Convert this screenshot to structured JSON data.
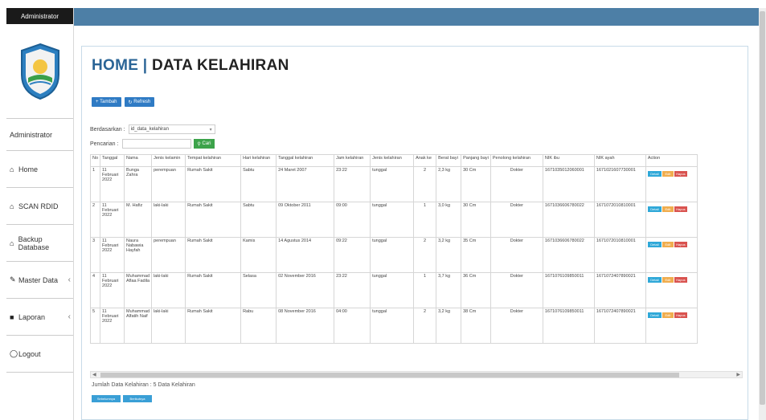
{
  "sidebar": {
    "header": "Administrator",
    "user": "Administrator",
    "items": [
      {
        "label": "Home",
        "icon": "home-icon"
      },
      {
        "label": "SCAN RDID",
        "icon": "home-icon"
      },
      {
        "label": "Backup Database",
        "icon": "home-icon"
      },
      {
        "label": "Master Data",
        "icon": "edit-icon",
        "expandable": true
      },
      {
        "label": "Laporan",
        "icon": "book-icon",
        "expandable": true
      },
      {
        "label": "Logout",
        "icon": "power-icon"
      }
    ]
  },
  "header": {
    "home": "HOME",
    "separator": "|",
    "page": "DATA KELAHIRAN"
  },
  "toolbar": {
    "tambah": "Tambah",
    "refresh": "Refresh"
  },
  "filter": {
    "berdasarkan_label": "Berdasarkan :",
    "berdasarkan_value": "id_data_kelahiran",
    "pencarian_label": "Pencarian :",
    "pencarian_value": "",
    "cari_button": "Cari"
  },
  "table": {
    "columns": [
      "No",
      "Tanggal",
      "Nama",
      "Jenis kelamin",
      "Tempat kelahiran",
      "Hari kelahiran",
      "Tanggal kelahiran",
      "Jam kelahiran",
      "Jenis kelahiran",
      "Anak ke",
      "Berat bayi",
      "Panjang bayi",
      "Penolong kelahiran",
      "NIK ibu",
      "NIK ayah",
      "Action"
    ],
    "rows": [
      [
        "1",
        "11 Februari 2022",
        "Bunga Zahra",
        "perempuan",
        "Rumah Sakit",
        "Sabtu",
        "24 Maret 2007",
        "23:22",
        "tunggal",
        "2",
        "2,3 kg",
        "30 Cm",
        "Dokter",
        "1671035012060001",
        "1671021607730001"
      ],
      [
        "2",
        "11 Februari 2022",
        "M. Hafiz",
        "laki-laki",
        "Rumah Sakit",
        "Sabtu",
        "09 Oktober 2011",
        "09:00",
        "tunggal",
        "1",
        "3,0 kg",
        "30 Cm",
        "Dokter",
        "1671036606780022",
        "1671072010810001"
      ],
      [
        "3",
        "11 Februari 2022",
        "Naura Nabawia Hayfah",
        "perempuan",
        "Rumah Sakit",
        "Kamis",
        "14 Agustus 2014",
        "09:22",
        "tunggal",
        "2",
        "3,2 kg",
        "35 Cm",
        "Dokter",
        "1671036606780022",
        "1671072010810001"
      ],
      [
        "4",
        "11 Februari 2022",
        "Muhammad Aflaa Fadila",
        "laki-laki",
        "Rumah Sakit",
        "Selasa",
        "02 November 2016",
        "23:22",
        "tunggal",
        "1",
        "3,7 kg",
        "36 Cm",
        "Dokter",
        "1671076109850011",
        "1671072407890021"
      ],
      [
        "5",
        "11 Februari 2022",
        "Muhammad Alfatih Naif",
        "laki-laki",
        "Rumah Sakit",
        "Rabu",
        "08 November 2016",
        "04:00",
        "tunggal",
        "2",
        "3,2 kg",
        "38 Cm",
        "Dokter",
        "1671076109850011",
        "1671072407890021"
      ]
    ],
    "actions": {
      "detail": "Detail",
      "edit": "Edit",
      "hapus": "Hapus"
    }
  },
  "footer": {
    "total": "Jumlah Data Kelahiran : 5 Data Kelahiran",
    "buttons": [
      "Sebelumnya",
      "Berikutnya"
    ]
  },
  "colors": {
    "topbar": "#4d7fa6",
    "title": "#2a6496",
    "primary": "#2f7bc4",
    "success": "#3ca34a",
    "detail": "#2fa8d8",
    "edit": "#f0ad4e",
    "hapus": "#d9534f"
  }
}
